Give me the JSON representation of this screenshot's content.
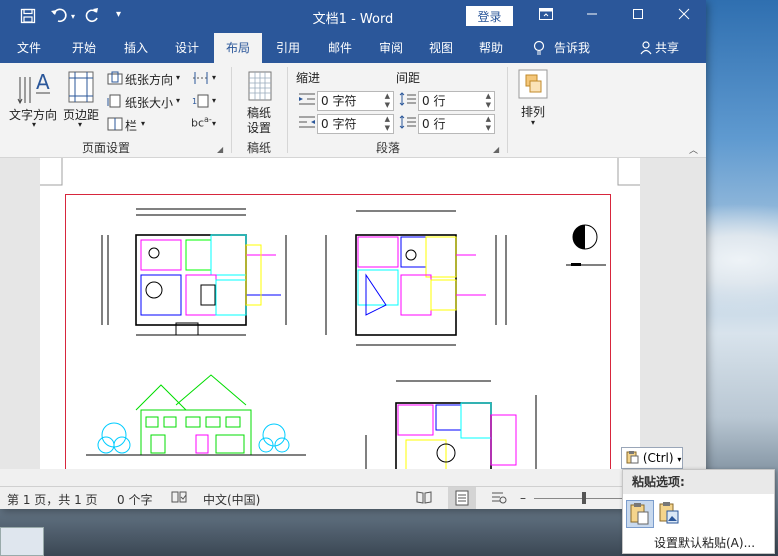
{
  "window": {
    "title": "文档1  -  Word",
    "login_label": "登录",
    "restore_icon": "ribbon-display-icon",
    "minimize_icon": "minimize-icon",
    "maximize_icon": "maximize-icon",
    "close_icon": "close-icon"
  },
  "quick_access": {
    "save_icon": "save-icon",
    "undo_icon": "undo-icon",
    "redo_icon": "redo-icon",
    "customize_icon": "customize-icon"
  },
  "tabs": [
    {
      "label": "文件"
    },
    {
      "label": "开始"
    },
    {
      "label": "插入"
    },
    {
      "label": "设计"
    },
    {
      "label": "布局"
    },
    {
      "label": "引用"
    },
    {
      "label": "邮件"
    },
    {
      "label": "审阅"
    },
    {
      "label": "视图"
    },
    {
      "label": "帮助"
    }
  ],
  "tell_me": "告诉我",
  "share": "共享",
  "ribbon": {
    "text_direction": "文字方向",
    "margins": "页边距",
    "orientation": "纸张方向",
    "size": "纸张大小",
    "columns": "栏",
    "group_page_setup": "页面设置",
    "manuscript_line1": "稿纸",
    "manuscript_line2": "设置",
    "group_manuscript": "稿纸",
    "indent_label": "缩进",
    "spacing_label": "间距",
    "indent_left": "0 字符",
    "indent_right": "0 字符",
    "spacing_before": "0 行",
    "spacing_after": "0 行",
    "group_paragraph": "段落",
    "arrange": "排列"
  },
  "statusbar": {
    "page": "第 1 页，共 1 页",
    "words": "0 个字",
    "language": "中文(中国)"
  },
  "paste": {
    "ctrl_label": "(Ctrl)",
    "title": "粘贴选项:",
    "default_label": "设置默认粘贴(A)..."
  }
}
